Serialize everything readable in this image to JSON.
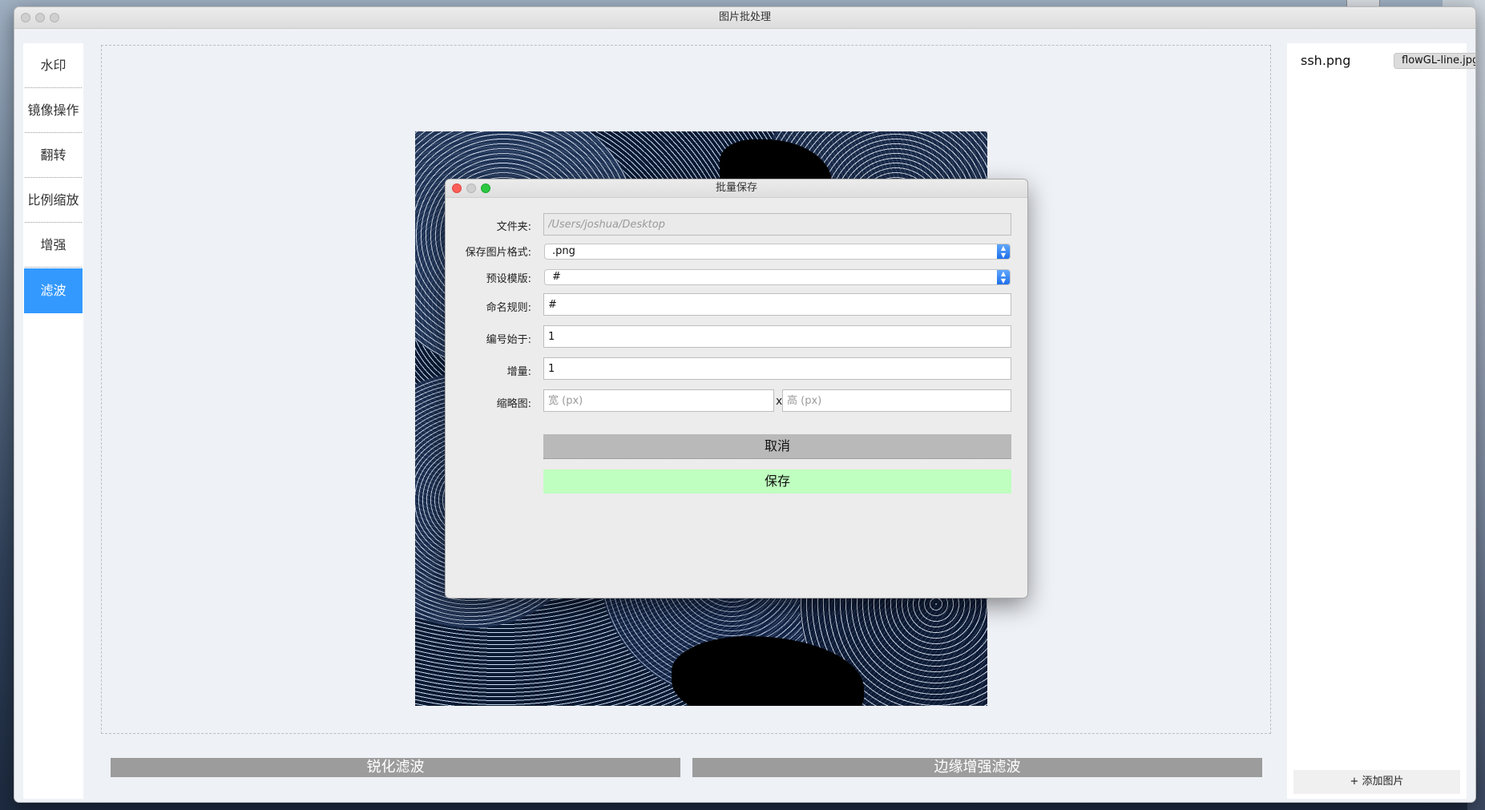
{
  "window": {
    "title": "图片批处理"
  },
  "sidebar": {
    "items": [
      {
        "label": "水印"
      },
      {
        "label": "镜像操作"
      },
      {
        "label": "翻转"
      },
      {
        "label": "比例缩放"
      },
      {
        "label": "增强"
      },
      {
        "label": "滤波",
        "active": true
      }
    ]
  },
  "filters": {
    "sharpen_label": "锐化滤波",
    "edge_label": "边缘增强滤波"
  },
  "files": {
    "items": [
      "flowGL-line.jpg",
      "ssh.png"
    ],
    "selected": "flowGL-line.jpg",
    "add_label": "+ 添加图片"
  },
  "dialog": {
    "title": "批量保存",
    "folder": {
      "label": "文件夹:",
      "value": "/Users/joshua/Desktop"
    },
    "format": {
      "label": "保存图片格式:",
      "value": ".png"
    },
    "template": {
      "label": "预设模版:",
      "value": "#"
    },
    "naming": {
      "label": "命名规则:",
      "value": "#"
    },
    "start": {
      "label": "编号始于:",
      "value": "1"
    },
    "increment": {
      "label": "增量:",
      "value": "1"
    },
    "thumbnail": {
      "label": "缩略图:",
      "width_placeholder": "宽 (px)",
      "height_placeholder": "高 (px)",
      "separator": "x"
    },
    "cancel_label": "取消",
    "save_label": "保存"
  },
  "colors": {
    "accent": "#3399ff",
    "save_button": "#bfffbf",
    "cancel_button": "#b9b9b9",
    "filter_button": "#9c9c9c"
  },
  "icons": [
    "close-dot-icon",
    "minimize-dot-icon",
    "zoom-dot-icon",
    "dropdown-arrow-icon"
  ]
}
